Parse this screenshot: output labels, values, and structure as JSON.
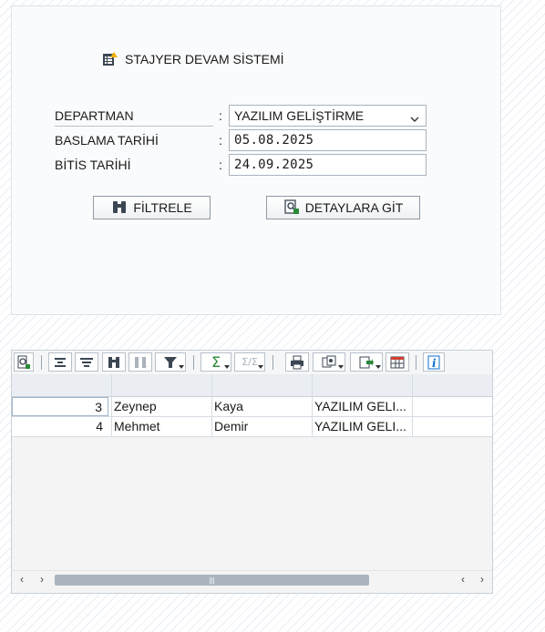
{
  "app": {
    "title": "STAJYER DEVAM SİSTEMİ",
    "icon": "document-list-icon"
  },
  "form": {
    "department": {
      "label": "DEPARTMAN",
      "colon": ":",
      "value": "YAZILIM GELİŞTİRME"
    },
    "start_date": {
      "label": "BASLAMA TARİHİ",
      "colon": ":",
      "value": "05.08.2025"
    },
    "end_date": {
      "label": "BİTİS TARİHİ",
      "colon": ":",
      "value": "24.09.2025"
    }
  },
  "buttons": {
    "filter": {
      "label": "FİLTRELE",
      "icon": "binoculars-icon"
    },
    "details": {
      "label": "DETAYLARA GİT",
      "icon": "details-icon"
    }
  },
  "toolbar": [
    "details-icon",
    "align-center-icon",
    "align-bottom-icon",
    "binoculars-icon",
    "find-next-icon",
    "filter-icon",
    "sum-icon",
    "subtotal-icon",
    "print-icon",
    "views-icon",
    "export-icon",
    "layout-icon",
    "info-icon"
  ],
  "grid": {
    "headers": [
      "",
      "",
      "",
      "",
      ""
    ],
    "rows": [
      {
        "id": "3",
        "first_name": "Zeynep",
        "last_name": "Kaya",
        "department": "YAZILIM GELI..."
      },
      {
        "id": "4",
        "first_name": "Mehmet",
        "last_name": "Demir",
        "department": "YAZILIM GELI..."
      }
    ]
  },
  "scrollbar": {
    "left_a": "‹",
    "left_b": "›",
    "right_a": "‹",
    "right_b": "›",
    "grip": "|||"
  },
  "colors": {
    "accent": "#0a6ed1",
    "icon_dark": "#3b4653",
    "icon_yellow": "#f0b400",
    "icon_green": "#2a8a3a"
  }
}
